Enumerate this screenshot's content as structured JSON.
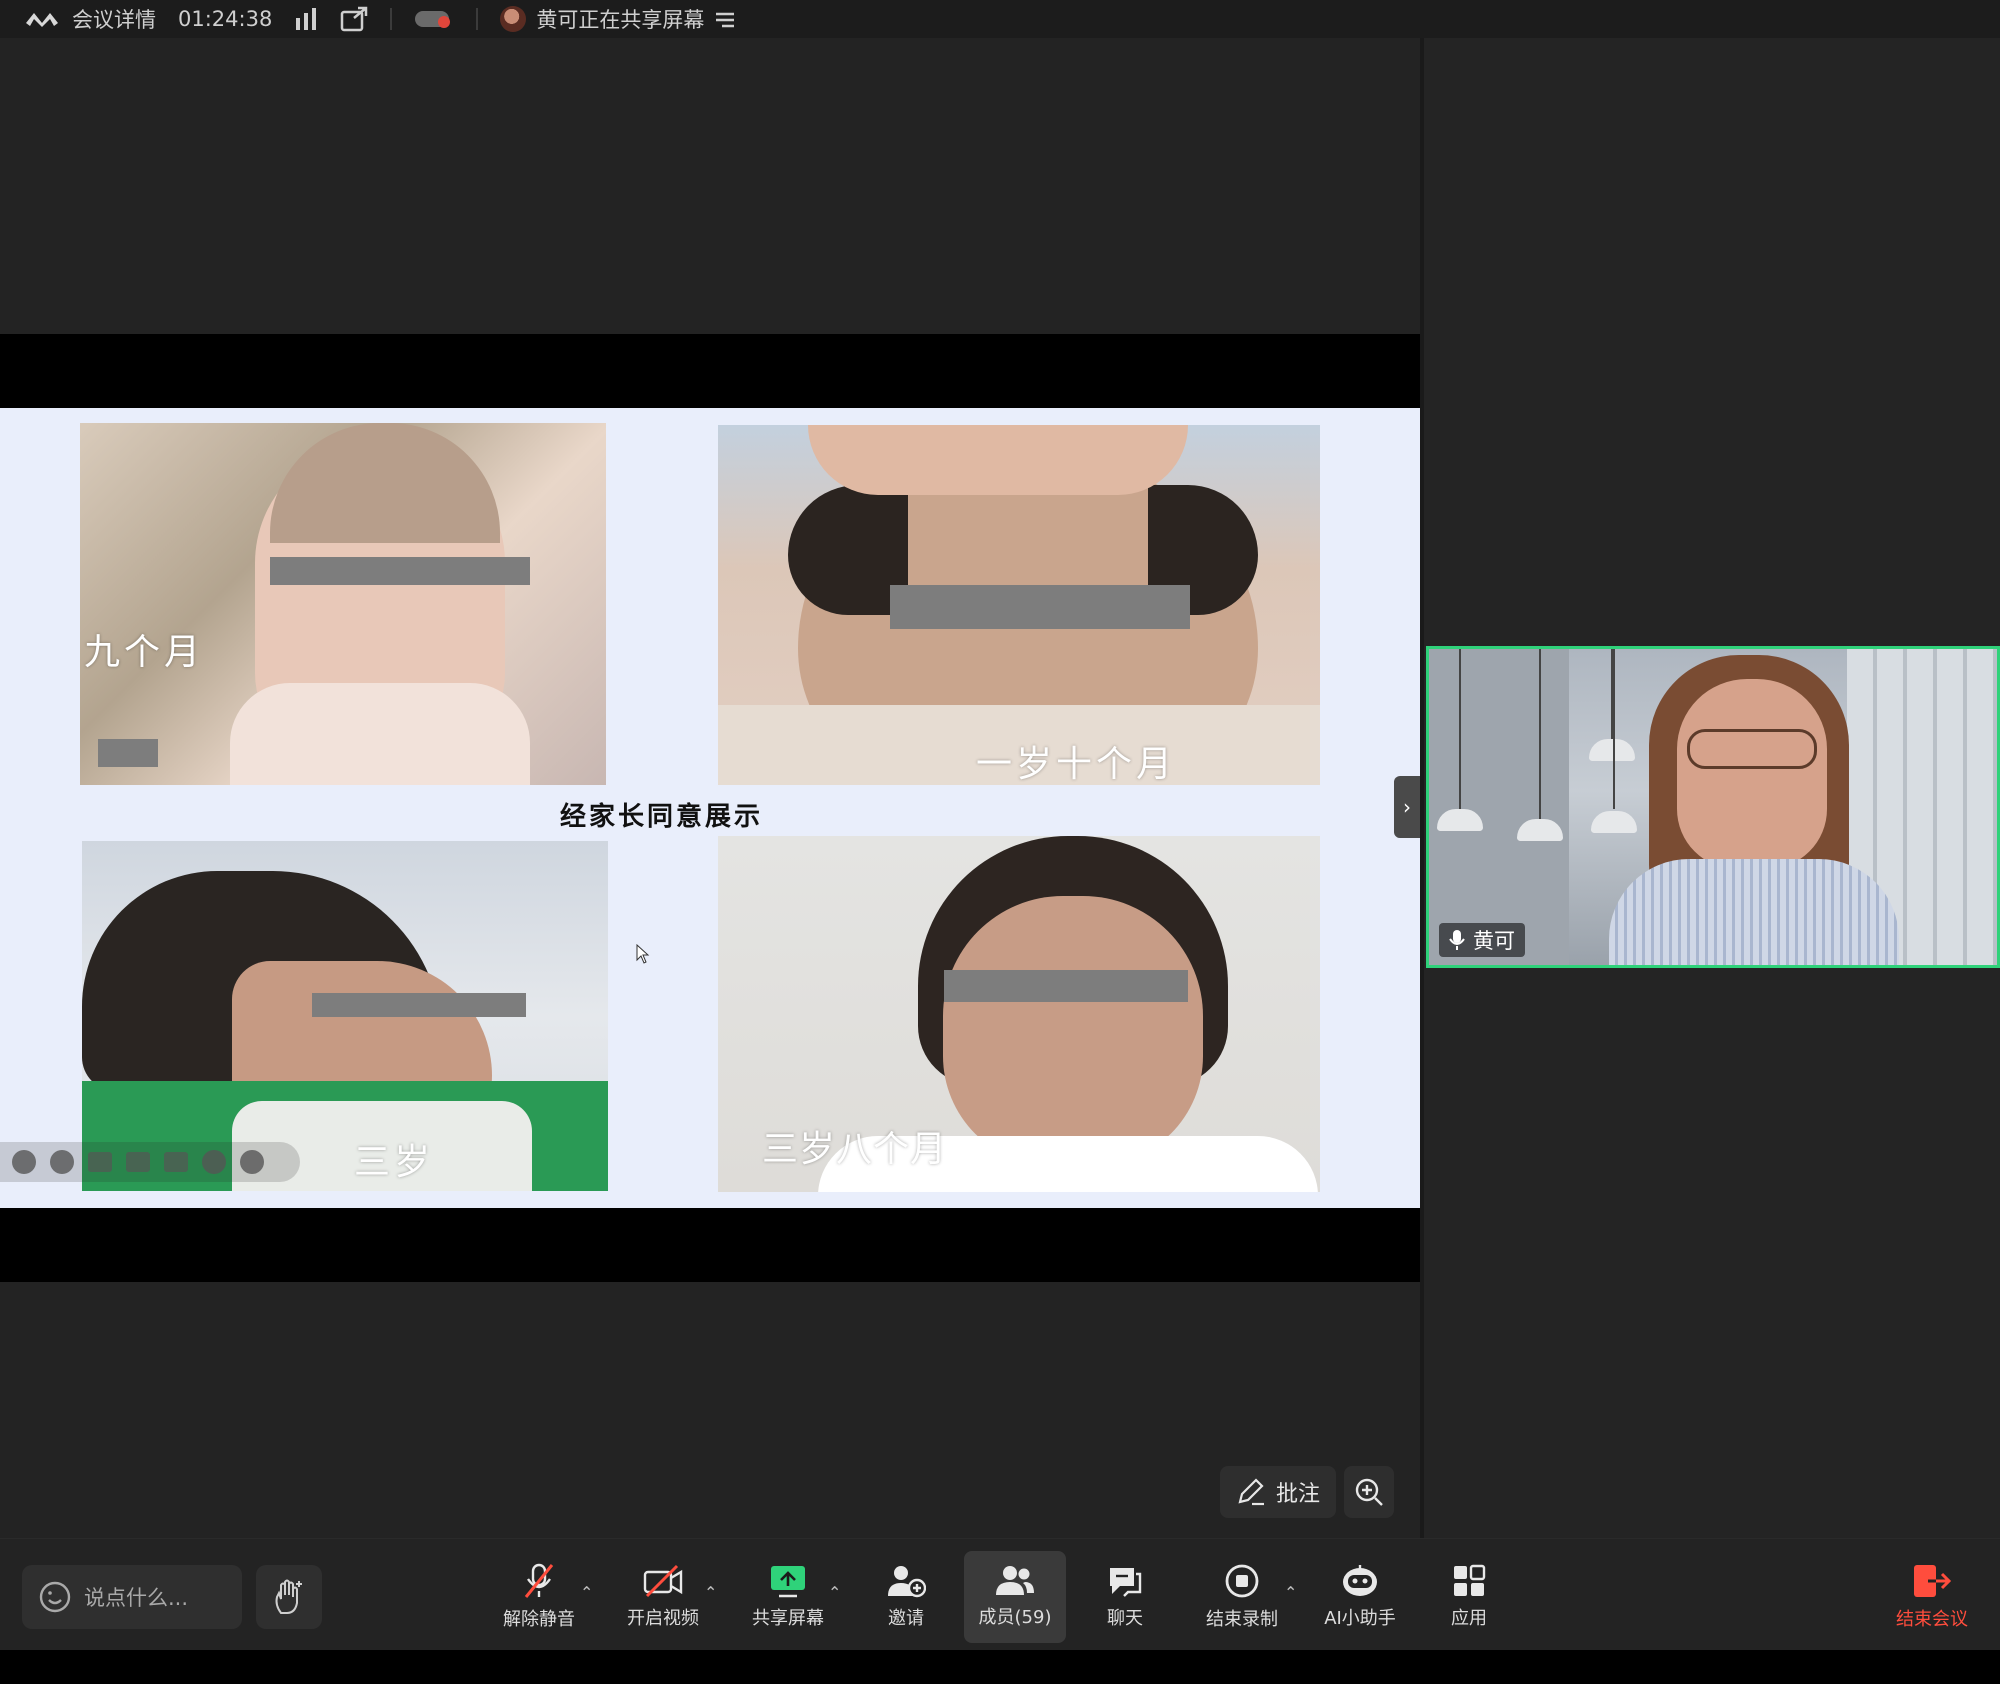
{
  "topbar": {
    "meeting_details": "会议详情",
    "timer": "01:24:38",
    "sharing_status": "黄可正在共享屏幕"
  },
  "slide": {
    "consent_text": "经家长同意展示",
    "photos": [
      {
        "caption": "九个月"
      },
      {
        "caption": "一岁十个月"
      },
      {
        "caption": "三岁"
      },
      {
        "caption": "三岁八个月"
      }
    ]
  },
  "annotate": {
    "label": "批注"
  },
  "speaker": {
    "name": "黄可"
  },
  "bottombar": {
    "say_placeholder": "说点什么...",
    "tools": {
      "unmute": "解除静音",
      "start_video": "开启视频",
      "share_screen": "共享屏幕",
      "invite": "邀请",
      "members": "成员(59)",
      "chat": "聊天",
      "end_recording": "结束录制",
      "ai_assistant": "AI小助手",
      "apps": "应用",
      "end_meeting": "结束会议"
    }
  },
  "colors": {
    "accent_green": "#2fd27a",
    "end_red": "#ff4d3d",
    "background": "#232323"
  }
}
